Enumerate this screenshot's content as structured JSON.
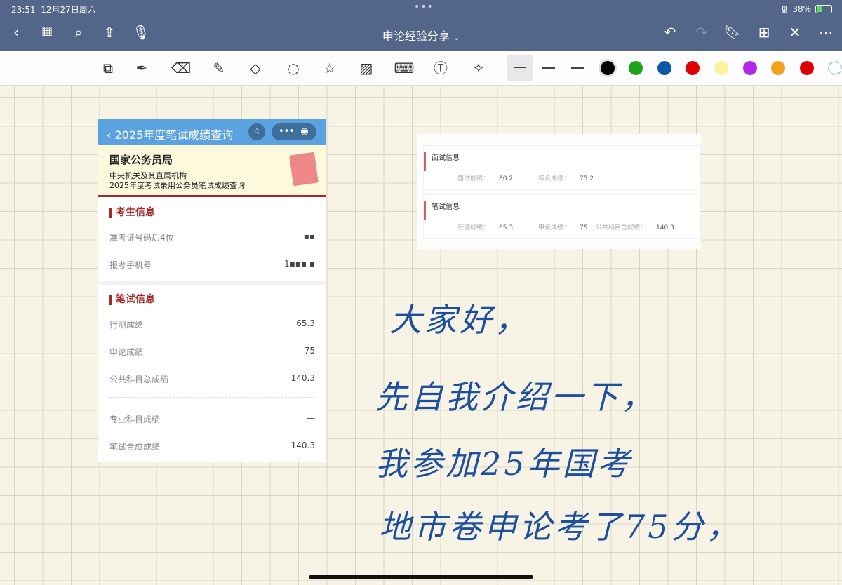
{
  "status": {
    "time": "23:51",
    "date": "12月27日周六",
    "battery": "38%"
  },
  "nav": {
    "title": "申论经验分享",
    "chevron": "⌄"
  },
  "colors": {
    "palette": [
      "#000000",
      "#1aa51a",
      "#0a57a8",
      "#e00000",
      "#fbf49a",
      "#b329e8",
      "#f5a01e",
      "#d90000"
    ],
    "accent": "#536689"
  },
  "card": {
    "header": "2025年度笔试成绩查询",
    "org": "国家公务员局",
    "sub1": "中央机关及其直属机构",
    "sub2": "2025年度考试录用公务员笔试成绩查询",
    "sec1": "考生信息",
    "id_label": "准考证号码后4位",
    "id_value": "▪▪",
    "phone_label": "报考手机号",
    "phone_value": "1▪▪▪ ▪",
    "sec2": "笔试信息",
    "rows": [
      {
        "label": "行测成绩",
        "value": "65.3"
      },
      {
        "label": "申论成绩",
        "value": "75"
      },
      {
        "label": "公共科目总成绩",
        "value": "140.3"
      }
    ],
    "rows2": [
      {
        "label": "专业科目成绩",
        "value": "—"
      },
      {
        "label": "笔试合成成绩",
        "value": "140.3"
      }
    ]
  },
  "shot": {
    "interview_title": "面试信息",
    "interview_label": "面试成绩：",
    "interview_value": "80.2",
    "total_label": "综合成绩：",
    "total_value": "75.2",
    "written_title": "笔试信息",
    "xc_label": "行测成绩：",
    "xc_value": "65.3",
    "sl_label": "申论成绩：",
    "sl_value": "75",
    "gg_label": "公共科目总成绩：",
    "gg_value": "140.3"
  },
  "handwriting": [
    "大家好，",
    "先自我介绍一下，",
    "我参加25年国考",
    "地市卷申论考了75分，"
  ]
}
